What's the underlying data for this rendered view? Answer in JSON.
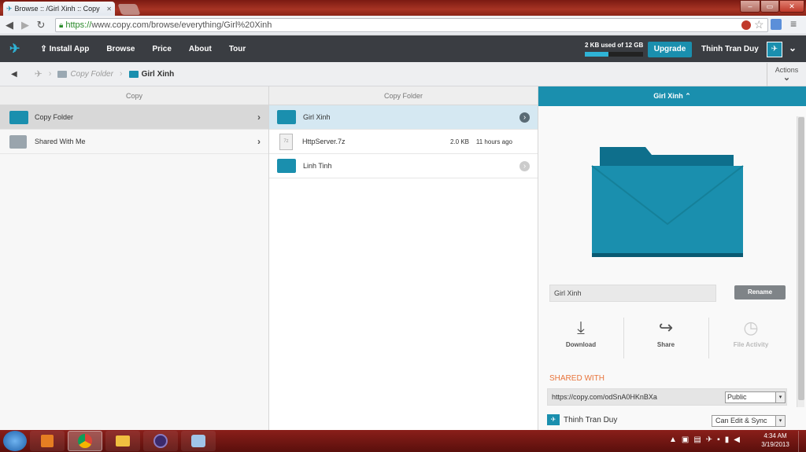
{
  "browser": {
    "tab_title": "Browse :: /Girl Xinh :: Copy",
    "url_scheme": "https://",
    "url_rest": "www.copy.com/browse/everything/Girl%20Xinh",
    "window_min": "–",
    "window_max": "▭",
    "window_close": "✕"
  },
  "appbar": {
    "install_app": "Install App",
    "browse": "Browse",
    "price": "Price",
    "about": "About",
    "tour": "Tour",
    "storage_text": "2 KB used of 12 GB",
    "storage_fraction": 0.4,
    "upgrade": "Upgrade",
    "user_name": "Thinh Tran Duy"
  },
  "breadcrumb": {
    "copy_folder": "Copy Folder",
    "current": "Girl Xinh",
    "actions": "Actions"
  },
  "column1": {
    "header": "Copy",
    "items": [
      {
        "label": "Copy Folder"
      },
      {
        "label": "Shared With Me"
      }
    ]
  },
  "column2": {
    "header": "Copy Folder",
    "items": [
      {
        "label": "Girl Xinh",
        "size": "",
        "modified": ""
      },
      {
        "label": "HttpServer.7z",
        "size": "2.0 KB",
        "modified": "11 hours ago"
      },
      {
        "label": "Linh Tinh",
        "size": "",
        "modified": ""
      }
    ]
  },
  "details": {
    "header": "Girl Xinh",
    "name_value": "Girl Xinh",
    "rename": "Rename",
    "download": "Download",
    "share": "Share",
    "file_activity": "File Activity",
    "shared_with": "SHARED WITH",
    "share_link": "https://copy.com/odSnA0HKnBXa",
    "visibility": "Public",
    "member_name": "Thinh Tran Duy",
    "member_permission": "Can Edit & Sync"
  },
  "taskbar": {
    "time": "4:34 AM",
    "date": "3/19/2013"
  },
  "colors": {
    "accent": "#1a8fae",
    "appbar": "#3a3d42",
    "shared_with_label": "#e8743b"
  }
}
